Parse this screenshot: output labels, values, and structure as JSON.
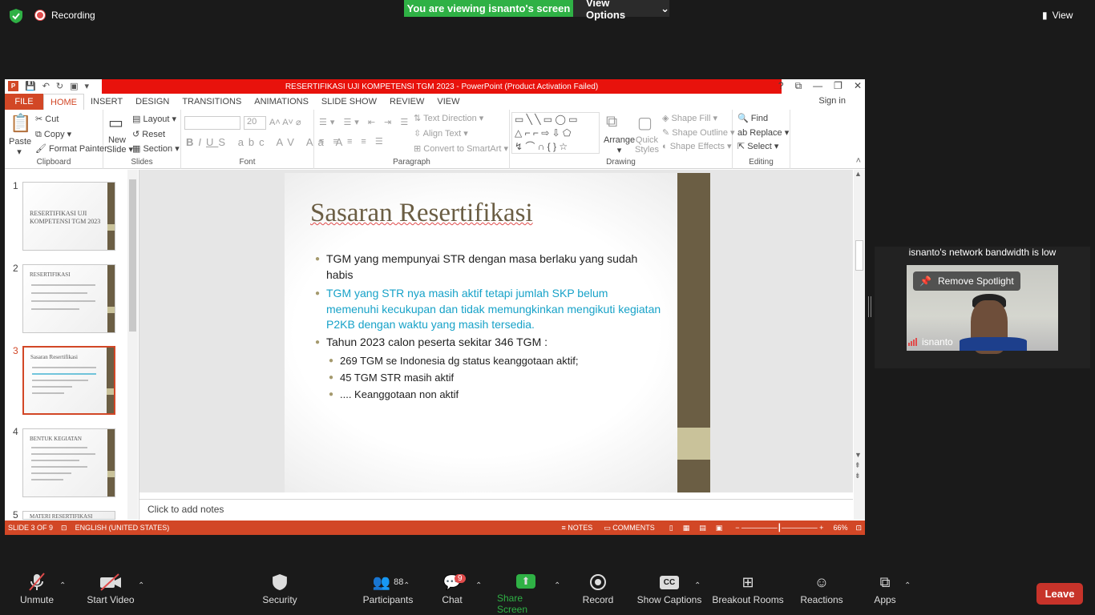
{
  "zoom": {
    "recording_label": "Recording",
    "viewing_banner": "You are viewing isnanto's screen",
    "view_options": "View Options",
    "view_button": "View",
    "bandwidth_warning": "isnanto's network bandwidth is low",
    "remove_spotlight": "Remove Spotlight",
    "participant_name": "isnanto",
    "toolbar": {
      "unmute": "Unmute",
      "start_video": "Start Video",
      "security": "Security",
      "participants": "Participants",
      "participants_count": "88",
      "chat": "Chat",
      "chat_badge": "9",
      "share_screen": "Share Screen",
      "record": "Record",
      "show_captions": "Show Captions",
      "breakout_rooms": "Breakout Rooms",
      "reactions": "Reactions",
      "apps": "Apps",
      "leave": "Leave"
    }
  },
  "ppt": {
    "title": "RESERTIFIKASI UJI KOMPETENSI TGM 2023  -  PowerPoint (Product Activation Failed)",
    "tabs": [
      "FILE",
      "HOME",
      "INSERT",
      "DESIGN",
      "TRANSITIONS",
      "ANIMATIONS",
      "SLIDE SHOW",
      "REVIEW",
      "VIEW"
    ],
    "sign_in": "Sign in",
    "ribbon": {
      "paste": "Paste",
      "cut": "Cut",
      "copy": "Copy",
      "format_painter": "Format Painter",
      "clipboard": "Clipboard",
      "new_slide": "New\nSlide",
      "layout": "Layout",
      "reset": "Reset",
      "section": "Section",
      "slides": "Slides",
      "font_size": "20",
      "font": "Font",
      "text_direction": "Text Direction",
      "align_text": "Align Text",
      "convert_smartart": "Convert to SmartArt",
      "paragraph": "Paragraph",
      "arrange": "Arrange",
      "quick_styles": "Quick\nStyles",
      "shape_fill": "Shape Fill",
      "shape_outline": "Shape Outline",
      "shape_effects": "Shape Effects",
      "drawing": "Drawing",
      "find": "Find",
      "replace": "Replace",
      "select": "Select",
      "editing": "Editing"
    },
    "thumbnails": [
      {
        "num": "1",
        "title": "RESERTIFIKASI UJI KOMPETENSI TGM 2023"
      },
      {
        "num": "2",
        "title": "RESERTIFIKASI"
      },
      {
        "num": "3",
        "title": "Sasaran Resertifikasi"
      },
      {
        "num": "4",
        "title": "BENTUK KEGIATAN"
      },
      {
        "num": "5",
        "title": "MATERI RESERTIFIKASI"
      }
    ],
    "slide": {
      "title": "Sasaran Resertifikasi",
      "bullet1": "TGM yang mempunyai STR dengan masa berlaku yang sudah habis",
      "bullet2": "TGM yang STR nya masih aktif tetapi jumlah SKP belum memenuhi kecukupan dan tidak memungkinkan mengikuti kegiatan P2KB dengan waktu yang masih tersedia.",
      "bullet3": "Tahun 2023 calon peserta sekitar 346 TGM :",
      "sub1": "269 TGM se Indonesia dg status keanggotaan aktif;",
      "sub2": "45 TGM STR masih aktif",
      "sub3": ".... Keanggotaan non aktif"
    },
    "notes_placeholder": "Click to add notes",
    "status": {
      "slide_of": "SLIDE 3 OF 9",
      "language": "ENGLISH (UNITED STATES)",
      "notes": "NOTES",
      "comments": "COMMENTS",
      "zoom": "66%"
    }
  }
}
